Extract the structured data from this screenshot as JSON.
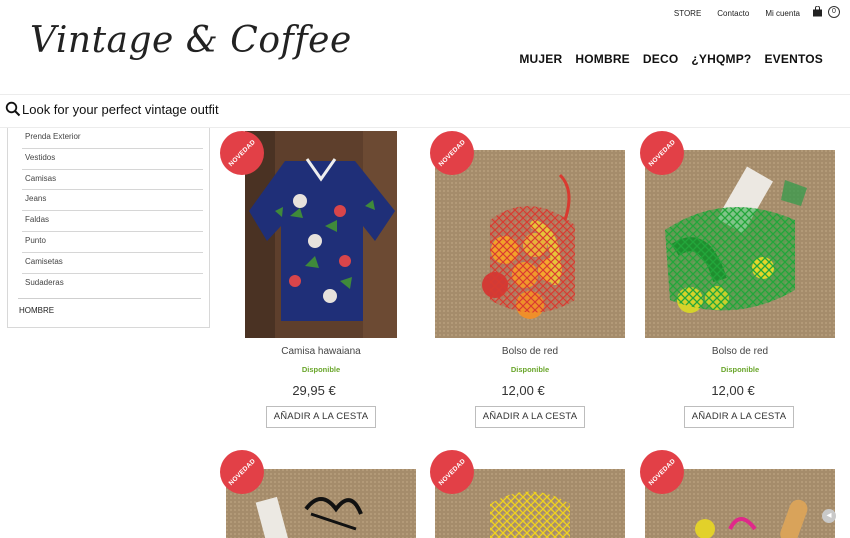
{
  "brand": {
    "logo_text": "Vintage & Coffee"
  },
  "top_links": [
    "STORE",
    "Contacto",
    "Mi cuenta"
  ],
  "cart": {
    "count": "0",
    "bag_icon": "shopping-bag-icon"
  },
  "main_nav": [
    "MUJER",
    "HOMBRE",
    "DECO",
    "¿YHQMP?",
    "EVENTOS"
  ],
  "search": {
    "text": "Look for your perfect vintage outfit",
    "icon": "search-icon"
  },
  "sidebar": {
    "subcategories": [
      "Prenda Exterior",
      "Vestidos",
      "Camisas",
      "Jeans",
      "Faldas",
      "Punto",
      "Camisetas",
      "Sudaderas"
    ],
    "category": "HOMBRE"
  },
  "badge_label": "NOVEDAD",
  "products": [
    {
      "name": "Camisa hawaiana",
      "availability": "Disponible",
      "price": "29,95 €",
      "button": "AÑADIR A LA CESTA"
    },
    {
      "name": "Bolso de red",
      "availability": "Disponible",
      "price": "12,00 €",
      "button": "AÑADIR A LA CESTA"
    },
    {
      "name": "Bolso de red",
      "availability": "Disponible",
      "price": "12,00 €",
      "button": "AÑADIR A LA CESTA"
    },
    {
      "name": "",
      "availability": "",
      "price": "",
      "button": ""
    },
    {
      "name": "",
      "availability": "",
      "price": "",
      "button": ""
    },
    {
      "name": "",
      "availability": "",
      "price": "",
      "button": ""
    }
  ],
  "colors": {
    "badge": "#e24047",
    "available": "#6aa62b",
    "burlap": "#a88f6f"
  }
}
